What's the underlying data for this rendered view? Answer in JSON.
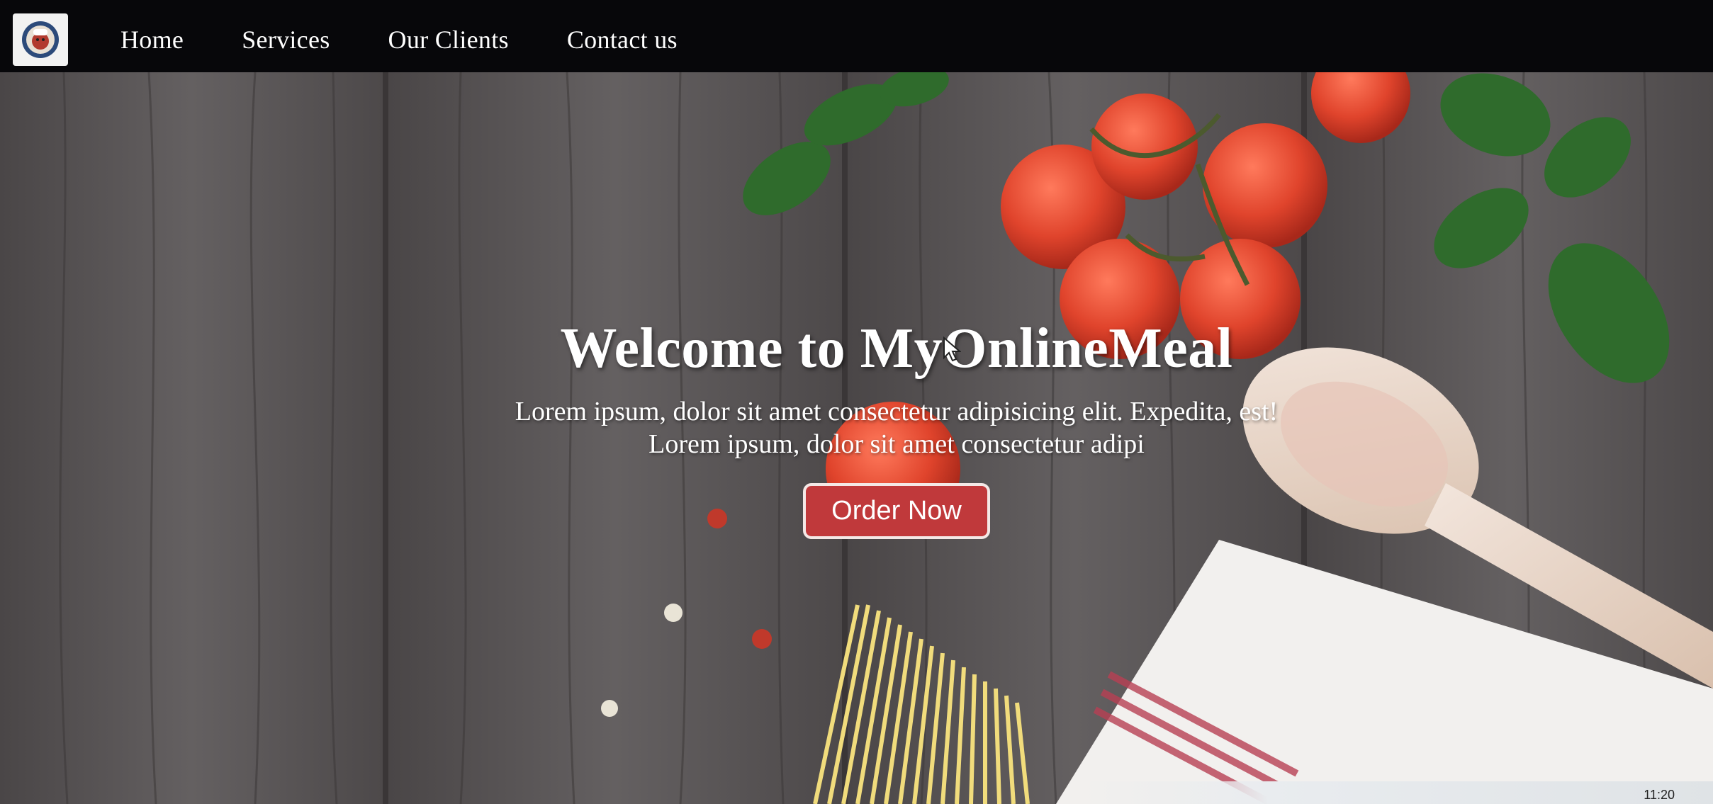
{
  "nav": {
    "logo_icon": "chef-logo-icon",
    "links": [
      {
        "label": "Home"
      },
      {
        "label": "Services"
      },
      {
        "label": "Our Clients"
      },
      {
        "label": "Contact us"
      }
    ]
  },
  "hero": {
    "title": "Welcome to MyOnlineMeal",
    "text_line1": "Lorem ipsum, dolor sit amet consectetur adipisicing elit. Expedita, est!",
    "text_line2": "Lorem ipsum, dolor sit amet consectetur adipi",
    "button_label": "Order Now",
    "background": "wooden-table-with-tomatoes-basil-spoon-pasta"
  },
  "system": {
    "clock": "11:20"
  },
  "colors": {
    "navbar": "#07070a",
    "button": "#c0393b",
    "wood": "#5b5758"
  }
}
